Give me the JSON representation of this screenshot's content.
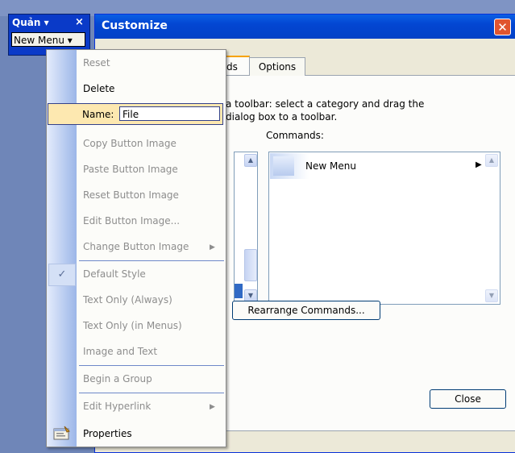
{
  "toolbar": {
    "title": "Quản ▾",
    "close": "×",
    "menu_label": "New Menu ▾"
  },
  "dialog": {
    "title": "Customize",
    "close": "✕",
    "tabs": {
      "commands": "ds",
      "options": "Options"
    },
    "description_line1": "a toolbar: select a category and drag the",
    "description_line2": "dialog box to a toolbar.",
    "commands_label": "Commands:",
    "command_item": "New Menu",
    "command_arrow": "▶",
    "rearrange_button": "Rearrange Commands...",
    "close_button": "Close"
  },
  "context_menu": {
    "items": [
      {
        "label": "Reset",
        "enabled": false
      },
      {
        "label": "Delete",
        "enabled": true
      },
      {
        "label": "Name:",
        "enabled": true
      },
      {
        "label": "Copy Button Image",
        "enabled": false
      },
      {
        "label": "Paste Button Image",
        "enabled": false
      },
      {
        "label": "Reset Button Image",
        "enabled": false
      },
      {
        "label": "Edit Button Image...",
        "enabled": false
      },
      {
        "label": "Change Button Image",
        "enabled": false
      },
      {
        "label": "Default Style",
        "enabled": false
      },
      {
        "label": "Text Only (Always)",
        "enabled": false
      },
      {
        "label": "Text Only (in Menus)",
        "enabled": false
      },
      {
        "label": "Image and Text",
        "enabled": false
      },
      {
        "label": "Begin a Group",
        "enabled": false
      },
      {
        "label": "Edit Hyperlink",
        "enabled": false
      },
      {
        "label": "Properties",
        "enabled": true
      }
    ],
    "name_value": "File",
    "submenu_arrow": "▶",
    "check": "✓"
  },
  "icons": {
    "properties": "properties-icon",
    "checkmark": "checkmark-icon"
  },
  "colors": {
    "titlebar": "#0346d2",
    "highlight": "#fde8b0",
    "disabled_text": "#8d8d8d"
  }
}
